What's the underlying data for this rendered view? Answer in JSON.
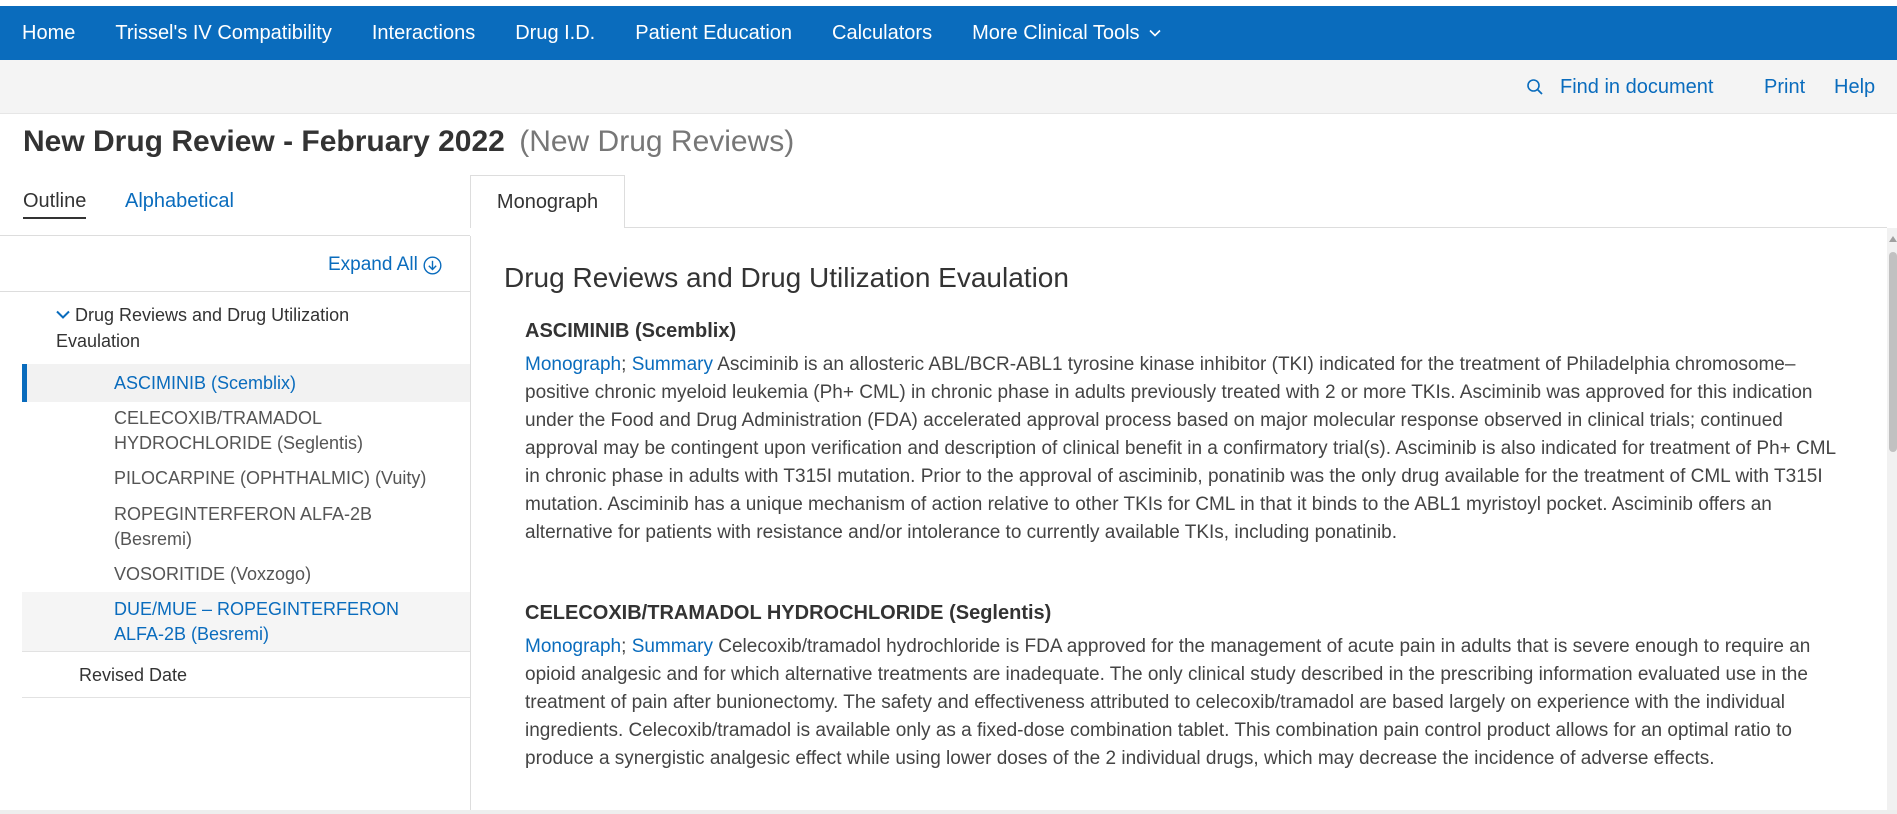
{
  "nav": {
    "items": [
      {
        "label": "Home"
      },
      {
        "label": "Trissel's IV Compatibility"
      },
      {
        "label": "Interactions"
      },
      {
        "label": "Drug I.D."
      },
      {
        "label": "Patient Education"
      },
      {
        "label": "Calculators"
      },
      {
        "label": "More Clinical Tools"
      }
    ],
    "more_icon": "chevron-down-icon"
  },
  "toolbar": {
    "find_label": "Find in document",
    "find_icon": "search-icon",
    "print_label": "Print",
    "help_label": "Help"
  },
  "page": {
    "title": "New Drug Review - February 2022",
    "subtitle": "(New Drug Reviews)"
  },
  "sidebar": {
    "tabs": [
      {
        "label": "Outline",
        "active": true
      },
      {
        "label": "Alphabetical",
        "active": false
      }
    ],
    "expand_all": "Expand All",
    "expand_icon": "circle-down-arrow-icon",
    "parent": "Drug Reviews and Drug Utilization Evaulation",
    "items": [
      {
        "label": "ASCIMINIB (Scemblix)",
        "state": "selected"
      },
      {
        "label": "CELECOXIB/TRAMADOL HYDROCHLORIDE (Seglentis)",
        "state": "normal"
      },
      {
        "label": "PILOCARPINE (OPHTHALMIC) (Vuity)",
        "state": "normal"
      },
      {
        "label": "ROPEGINTERFERON ALFA-2B (Besremi)",
        "state": "normal"
      },
      {
        "label": "VOSORITIDE (Voxzogo)",
        "state": "normal"
      },
      {
        "label": "DUE/MUE – ROPEGINTERFERON ALFA-2B (Besremi)",
        "state": "link"
      }
    ],
    "revised": "Revised Date"
  },
  "content": {
    "tab": "Monograph",
    "heading": "Drug Reviews and Drug Utilization Evaulation",
    "drugs": [
      {
        "name": "ASCIMINIB (Scemblix)",
        "link1": "Monograph",
        "sep": ";",
        "link2": "Summary",
        "text": " Asciminib is an allosteric ABL/BCR-ABL1 tyrosine kinase inhibitor (TKI) indicated for the treatment of Philadelphia chromosome–positive chronic myeloid leukemia (Ph+ CML) in chronic phase in adults previously treated with 2 or more TKIs. Asciminib was approved for this indication under the Food and Drug Administration (FDA) accelerated approval process based on major molecular response observed in clinical trials; continued approval may be contingent upon verification and description of clinical benefit in a confirmatory trial(s). Asciminib is also indicated for treatment of Ph+ CML in chronic phase in adults with T315I mutation. Prior to the approval of asciminib, ponatinib was the only drug available for the treatment of CML with T315I mutation. Asciminib has a unique mechanism of action relative to other TKIs for CML in that it binds to the ABL1 myristoyl pocket. Asciminib offers an alternative for patients with resistance and/or intolerance to currently available TKIs, including ponatinib."
      },
      {
        "name": "CELECOXIB/TRAMADOL HYDROCHLORIDE (Seglentis)",
        "link1": "Monograph",
        "sep": ";",
        "link2": "Summary",
        "text": " Celecoxib/tramadol hydrochloride is FDA approved for the management of acute pain in adults that is severe enough to require an opioid analgesic and for which alternative treatments are inadequate. The only clinical study described in the prescribing information evaluated use in the treatment of pain after bunionectomy. The safety and effectiveness attributed to celecoxib/tramadol are based largely on experience with the individual ingredients. Celecoxib/tramadol is available only as a fixed-dose combination tablet. This combination pain control product allows for an optimal ratio to produce a synergistic analgesic effect while using lower doses of the 2 individual drugs, which may decrease the incidence of adverse effects."
      }
    ]
  },
  "colors": {
    "brand": "#0a6cbd",
    "text": "#333333",
    "muted": "#777777"
  }
}
